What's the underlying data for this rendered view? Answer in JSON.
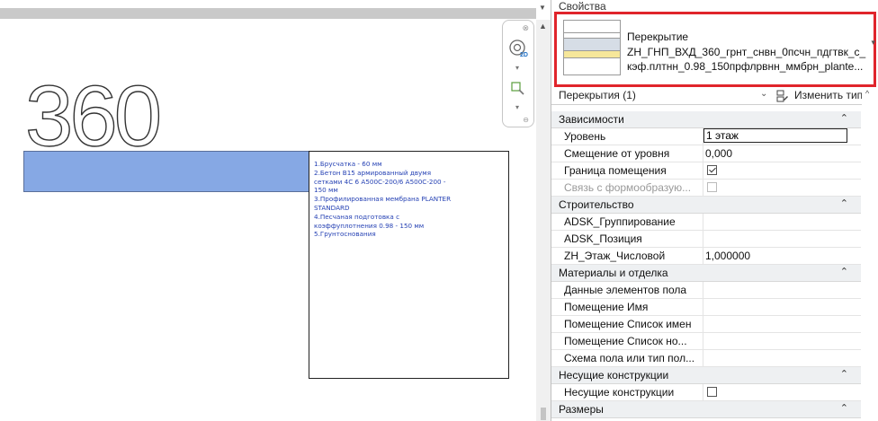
{
  "canvas": {
    "dimension_number": "360",
    "notes": [
      "1.Брусчатка - 60 мм",
      "2.Бетон В15 армированный двумя",
      "сетками 4С 6 А500С-200/6 А500С-200 -",
      "150 мм",
      "3.Профилированная мембрана PLANTER",
      "STANDARD",
      "4.Песчаная подготовка с",
      "коэффуплотнения 0.98 - 150 мм",
      "5.Грунтоснования"
    ]
  },
  "panel": {
    "title": "Свойства",
    "type_selector": {
      "family": "Перекрытие",
      "type_line1": "ZH_ГНП_ВХД_360_грнт_снвн_0псчн_пдгтвк_с_",
      "type_line2": "кэф.плтнн_0.98_150прфлрвнн_ммбрн_plante..."
    },
    "filter_label": "Перекрытия (1)",
    "edit_type_label": "Изменить тип",
    "groups": [
      {
        "name": "Зависимости",
        "rows": [
          {
            "name": "Уровень",
            "value": "1 этаж",
            "kind": "edit"
          },
          {
            "name": "Смещение от уровня",
            "value": "0,000",
            "kind": "text"
          },
          {
            "name": "Граница помещения",
            "value": "",
            "kind": "checkbox-checked"
          },
          {
            "name": "Связь с формообразую...",
            "value": "",
            "kind": "checkbox-disabled"
          }
        ]
      },
      {
        "name": "Строительство",
        "rows": [
          {
            "name": "ADSK_Группирование",
            "value": "",
            "kind": "button"
          },
          {
            "name": "ADSK_Позиция",
            "value": "",
            "kind": "button"
          },
          {
            "name": "ZH_Этаж_Числовой",
            "value": "1,000000",
            "kind": "button"
          }
        ]
      },
      {
        "name": "Материалы и отделка",
        "rows": [
          {
            "name": "Данные элементов пола",
            "value": "",
            "kind": "button"
          },
          {
            "name": "Помещение Имя",
            "value": "",
            "kind": "button"
          },
          {
            "name": "Помещение Список имен",
            "value": "",
            "kind": "button"
          },
          {
            "name": "Помещение Список но...",
            "value": "",
            "kind": "button"
          },
          {
            "name": "Схема пола или тип пол...",
            "value": "",
            "kind": "button"
          }
        ]
      },
      {
        "name": "Несущие конструкции",
        "rows": [
          {
            "name": "Несущие конструкции",
            "value": "",
            "kind": "checkbox"
          }
        ]
      },
      {
        "name": "Размеры",
        "rows": []
      }
    ]
  }
}
